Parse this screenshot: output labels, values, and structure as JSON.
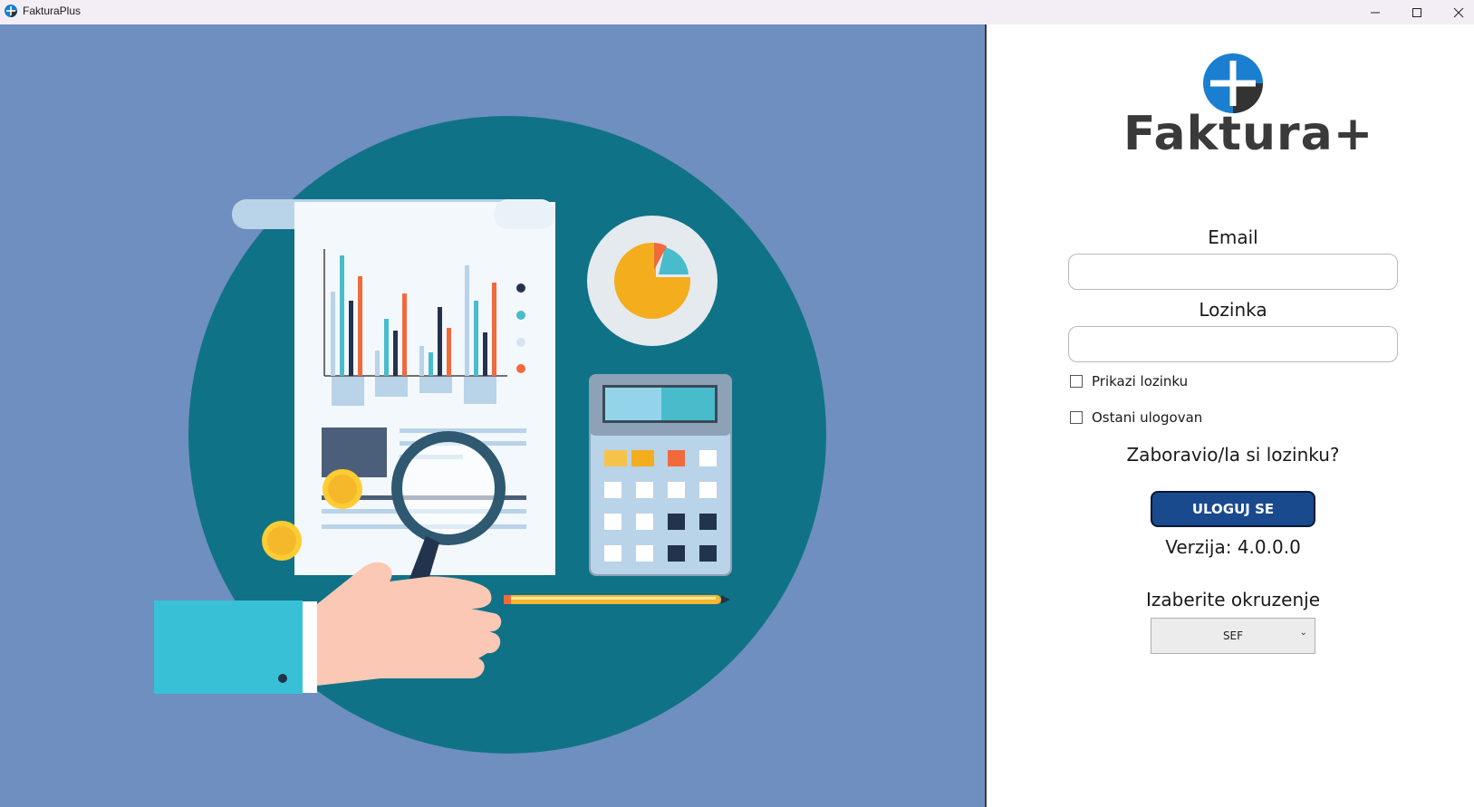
{
  "window": {
    "title": "FakturaPlus"
  },
  "brand": {
    "logo_text": "Faktura+",
    "primary_color": "#1a7fd0",
    "dark_color": "#333333"
  },
  "form": {
    "email_label": "Email",
    "email_value": "",
    "password_label": "Lozinka",
    "password_value": "",
    "show_password_label": "Prikazi lozinku",
    "show_password_checked": false,
    "stay_logged_label": "Ostani ulogovan",
    "stay_logged_checked": false,
    "forgot_password": "Zaboravio/la si lozinku?",
    "login_button": "ULOGUJ SE",
    "version": "Verzija: 4.0.0.0",
    "environment_label": "Izaberite okruzenje",
    "environment_value": "SEF"
  },
  "colors": {
    "left_background": "#6e8fc0",
    "circle": "#107287",
    "button": "#1a4a8e"
  }
}
